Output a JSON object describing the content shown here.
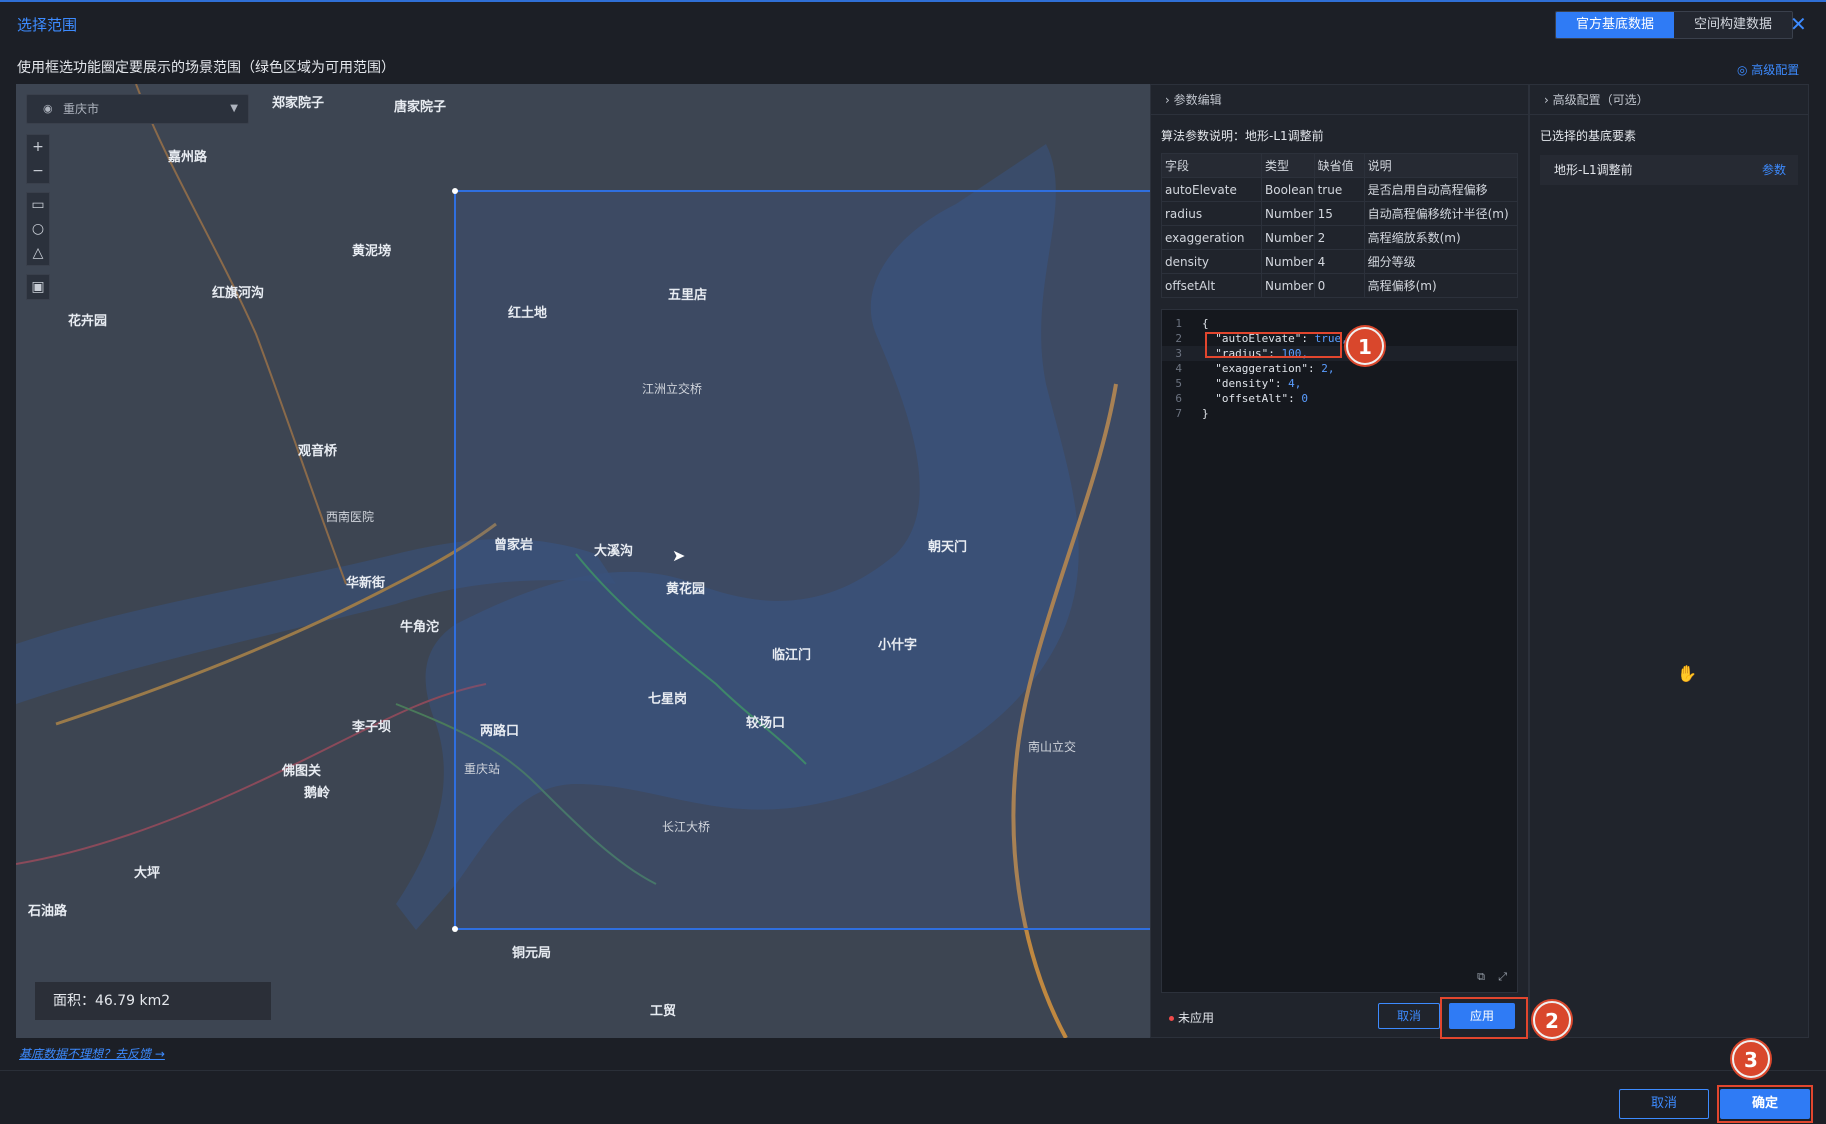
{
  "header": {
    "title": "选择范围",
    "tabs": [
      "官方基底数据",
      "空间构建数据"
    ],
    "active_tab": 0,
    "close_icon": "close-icon"
  },
  "subtitle": "使用框选功能圈定要展示的场景范围（绿色区域为可用范围）",
  "advanced_link": "◎ 高级配置",
  "map": {
    "city_select": "重庆市",
    "area_text": "面积：46.79 km2",
    "labels": [
      {
        "text": "郑家院子"
      },
      {
        "text": "唐家院子"
      },
      {
        "text": "嘉州路"
      },
      {
        "text": "红旗河沟"
      },
      {
        "text": "黄泥塝"
      },
      {
        "text": "花卉园"
      },
      {
        "text": "红土地"
      },
      {
        "text": "五里店"
      },
      {
        "text": "江洲立交桥"
      },
      {
        "text": "观音桥"
      },
      {
        "text": "西南医院"
      },
      {
        "text": "华新街"
      },
      {
        "text": "牛角沱"
      },
      {
        "text": "李子坝"
      },
      {
        "text": "两路口"
      },
      {
        "text": "佛图关"
      },
      {
        "text": "鹅岭"
      },
      {
        "text": "大坪"
      },
      {
        "text": "石油路"
      },
      {
        "text": "曾家岩"
      },
      {
        "text": "大溪沟"
      },
      {
        "text": "黄花园"
      },
      {
        "text": "临江门"
      },
      {
        "text": "小什字"
      },
      {
        "text": "七星岗"
      },
      {
        "text": "较场口"
      },
      {
        "text": "朝天门"
      },
      {
        "text": "铜元局"
      },
      {
        "text": "工贸"
      },
      {
        "text": "南山立交"
      },
      {
        "text": "长江大桥"
      },
      {
        "text": "重庆站"
      }
    ]
  },
  "feedback_link": "基底数据不理想？去反馈 →",
  "params_panel": {
    "header": "参数编辑",
    "algo_note": "算法参数说明：地形-L1调整前",
    "table_headers": [
      "字段",
      "类型",
      "缺省值",
      "说明"
    ],
    "rows": [
      [
        "autoElevate",
        "Boolean",
        "true",
        "是否启用自动高程偏移"
      ],
      [
        "radius",
        "Number",
        "15",
        "自动高程偏移统计半径(m)"
      ],
      [
        "exaggeration",
        "Number",
        "2",
        "高程缩放系数(m)"
      ],
      [
        "density",
        "Number",
        "4",
        "细分等级"
      ],
      [
        "offsetAlt",
        "Number",
        "0",
        "高程偏移(m)"
      ]
    ],
    "code_lines": [
      {
        "n": "1",
        "key": "{",
        "val": ""
      },
      {
        "n": "2",
        "key": "  \"autoElevate\": ",
        "val": "true,"
      },
      {
        "n": "3",
        "key": "  \"radius\": ",
        "val": "100,"
      },
      {
        "n": "4",
        "key": "  \"exaggeration\": ",
        "val": "2,"
      },
      {
        "n": "5",
        "key": "  \"density\": ",
        "val": "4,"
      },
      {
        "n": "6",
        "key": "  \"offsetAlt\": ",
        "val": "0"
      },
      {
        "n": "7",
        "key": "}",
        "val": ""
      }
    ],
    "status": "未应用",
    "cancel": "取消",
    "apply": "应用"
  },
  "advanced_panel": {
    "header": "高级配置（可选）",
    "selected_title": "已选择的基底要素",
    "item": "地形-L1调整前",
    "item_link": "参数"
  },
  "footer": {
    "cancel": "取消",
    "ok": "确定"
  },
  "annotations": [
    "1",
    "2",
    "3"
  ],
  "colors": {
    "accent": "#2f7bf5",
    "highlight": "#e2462e",
    "selection": "#2f6fe0"
  }
}
